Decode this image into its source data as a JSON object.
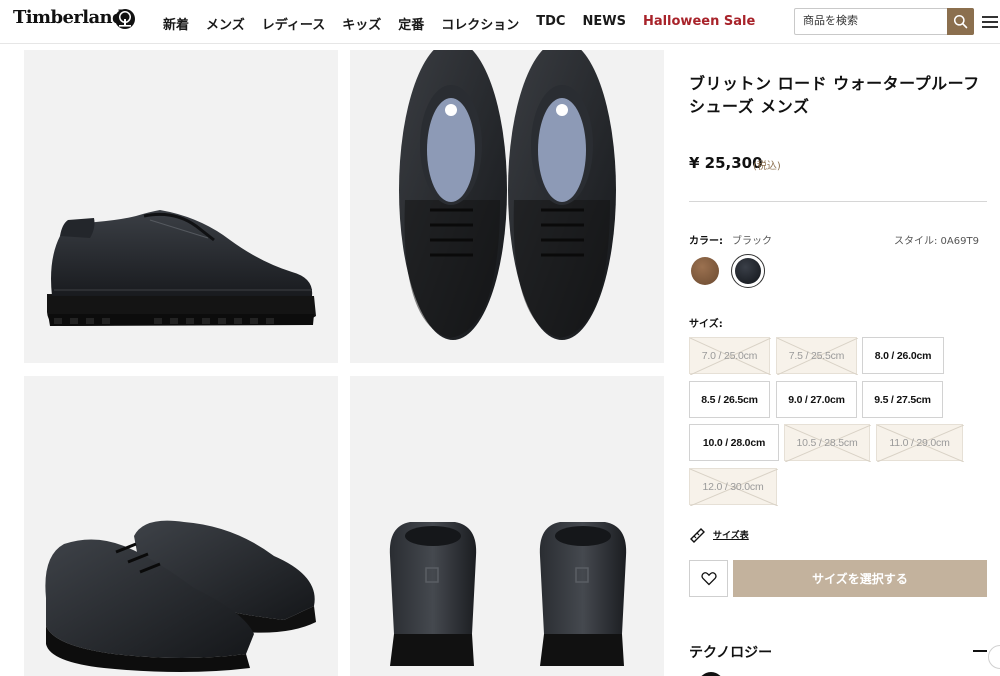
{
  "header": {
    "logo": "Timberland",
    "nav": [
      "新着",
      "メンズ",
      "レディース",
      "キッズ",
      "定番",
      "コレクション",
      "TDC",
      "NEWS",
      "Halloween Sale"
    ],
    "search_placeholder": "商品を検索"
  },
  "product": {
    "title": "ブリットン ロード ウォータープルーフ シューズ メンズ",
    "price": "¥ 25,300",
    "tax_note": "(税込)",
    "color_label": "カラー:",
    "color_value": "ブラック",
    "style": "スタイル: 0A69T9",
    "colors": [
      {
        "name": "brown",
        "hex": "#7a5538"
      },
      {
        "name": "black",
        "hex": "#1b1f26",
        "selected": true
      }
    ],
    "size_label": "サイズ:",
    "sizes": [
      {
        "label": "7.0 / 25.0cm",
        "available": false
      },
      {
        "label": "7.5 / 25.5cm",
        "available": false
      },
      {
        "label": "8.0 / 26.0cm",
        "available": true
      },
      {
        "label": "8.5 / 26.5cm",
        "available": true
      },
      {
        "label": "9.0 / 27.0cm",
        "available": true
      },
      {
        "label": "9.5 / 27.5cm",
        "available": true
      },
      {
        "label": "10.0 / 28.0cm",
        "available": true
      },
      {
        "label": "10.5 / 28.5cm",
        "available": false
      },
      {
        "label": "11.0 / 29.0cm",
        "available": false
      },
      {
        "label": "12.0 / 30.0cm",
        "available": false
      }
    ],
    "size_chart": "サイズ表",
    "select_button": "サイズを選択する",
    "technology": "テクノロジー"
  },
  "colors": {
    "accent": "#8b6f4e",
    "sale": "#a8232a",
    "cta": "#c3b29d",
    "unavailable_bg": "#f7f2ea"
  }
}
